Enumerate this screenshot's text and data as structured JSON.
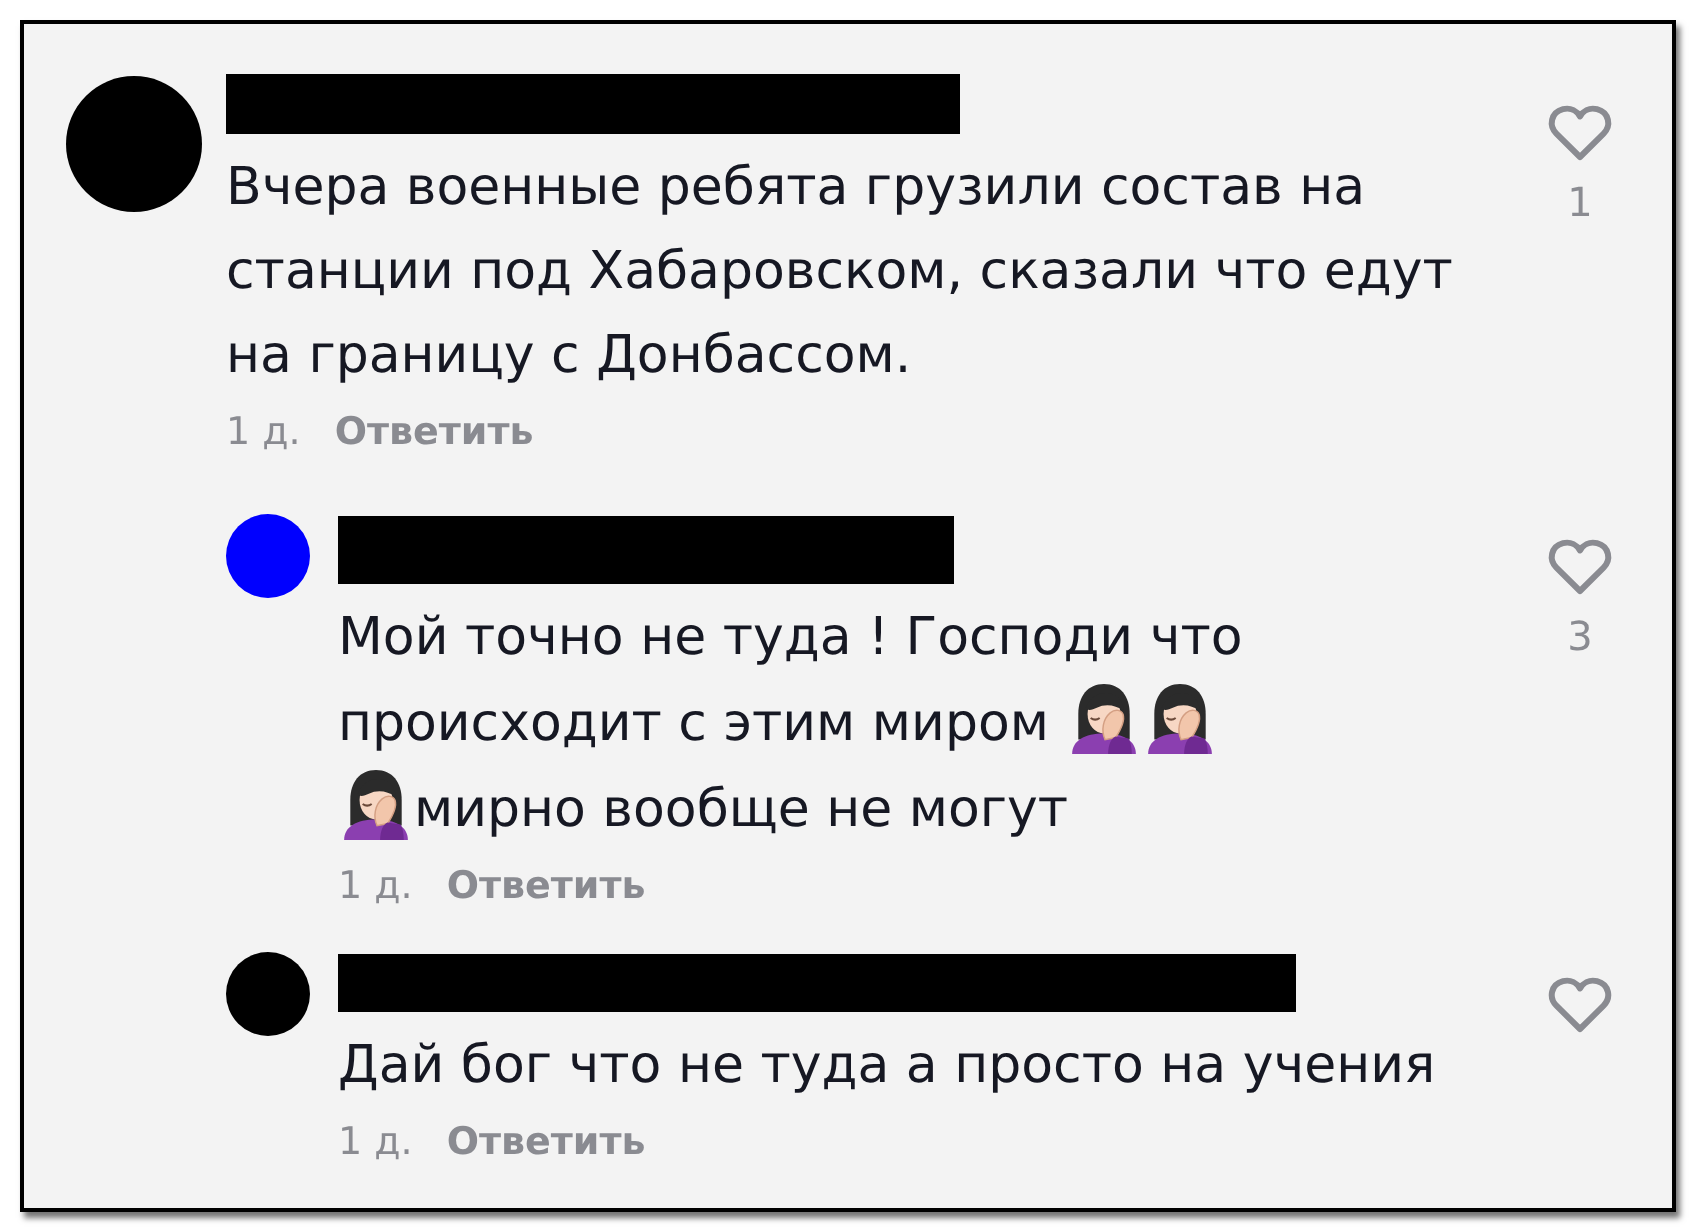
{
  "comments": [
    {
      "avatar": {
        "color": "#000000"
      },
      "text": [
        {
          "kind": "text",
          "text": "Вчера военные ребята грузили состав на станции под Хабаровском, сказали что едут на границу с Донбассом."
        }
      ],
      "time": "1 д.",
      "reply_action": "Ответить",
      "likes": "1",
      "replies": [
        {
          "avatar": {
            "color": "#0000ff"
          },
          "text": [
            {
              "kind": "text",
              "text": "Мой точно не туда ! Господи что"
            },
            {
              "kind": "text",
              "text": "происходит с этим миром"
            },
            {
              "kind": "emoji"
            },
            {
              "kind": "emoji"
            },
            {
              "kind": "emoji"
            },
            {
              "kind": "text",
              "text": "мирно вообще не могут"
            }
          ],
          "time": "1 д.",
          "reply_action": "Ответить",
          "likes": "3"
        },
        {
          "avatar": {
            "color": "#000000"
          },
          "text": [
            {
              "kind": "text",
              "text": "Дай бог что не туда а просто на учения"
            }
          ],
          "time": "1 д.",
          "reply_action": "Ответить"
        }
      ]
    }
  ]
}
